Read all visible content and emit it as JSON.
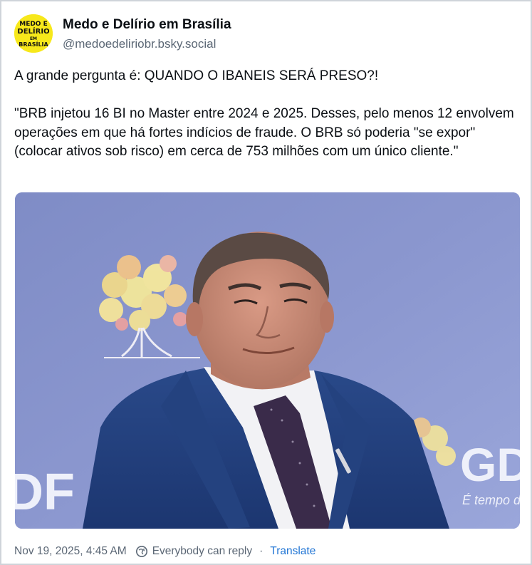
{
  "post": {
    "author": {
      "display_name": "Medo e Delírio em Brasília",
      "handle": "@medoedeliriobr.bsky.social",
      "avatar_icon": "medo-e-delirio-logo",
      "avatar_color": "#f7e81b"
    },
    "text_paragraphs": [
      "A grande pergunta é: QUANDO O IBANEIS SERÁ PRESO?!",
      "\"BRB injetou 16 BI no Master entre 2024 e 2025. Desses, pelo menos 12 envolvem operações em que há fortes indícios de fraude. O BRB só poderia \"se expor\" (colocar ativos sob risco) em cerca de 753 milhões com um único cliente.\""
    ],
    "image": {
      "background_letters_left": "DF",
      "background_letters_right": "GD",
      "background_tagline": "É tempo d"
    },
    "footer": {
      "timestamp": "Nov 19, 2025, 4:45 AM",
      "reply_setting": "Everybody can reply",
      "separator": "·",
      "translate_label": "Translate",
      "reply_icon": "everybody-reply-icon"
    }
  },
  "colors": {
    "text": "#0b0f14",
    "secondary_text": "#5b6775",
    "link": "#1f74d4",
    "border": "#cfd4da"
  }
}
